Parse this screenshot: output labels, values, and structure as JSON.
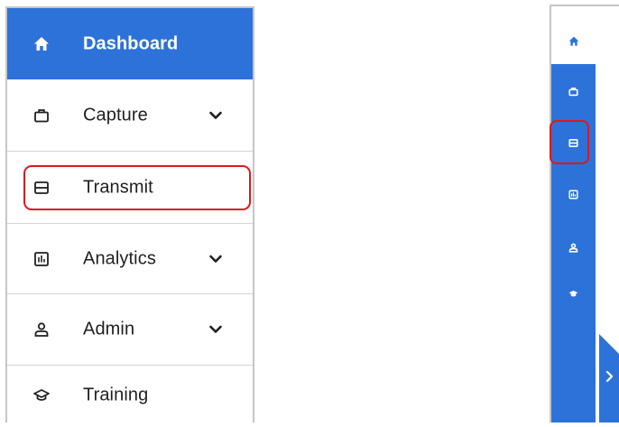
{
  "colors": {
    "accent": "#2d72d9",
    "highlight": "#e0161b",
    "text": "#1f1f1f"
  },
  "sidebar_expanded": {
    "items": [
      {
        "label": "Dashboard",
        "icon": "home-icon",
        "active": true,
        "expandable": false
      },
      {
        "label": "Capture",
        "icon": "briefcase-icon",
        "active": false,
        "expandable": true
      },
      {
        "label": "Transmit",
        "icon": "tray-icon",
        "active": false,
        "expandable": false,
        "highlighted": true
      },
      {
        "label": "Analytics",
        "icon": "chart-icon",
        "active": false,
        "expandable": true
      },
      {
        "label": "Admin",
        "icon": "user-icon",
        "active": false,
        "expandable": true
      },
      {
        "label": "Training",
        "icon": "graduation-cap-icon",
        "active": false,
        "expandable": false
      }
    ]
  },
  "sidebar_collapsed": {
    "icons": [
      "home-icon",
      "briefcase-icon",
      "tray-icon",
      "chart-icon",
      "user-icon",
      "graduation-cap-icon"
    ],
    "highlighted": "tray-icon",
    "expand_icon": "chevron-right-icon"
  }
}
